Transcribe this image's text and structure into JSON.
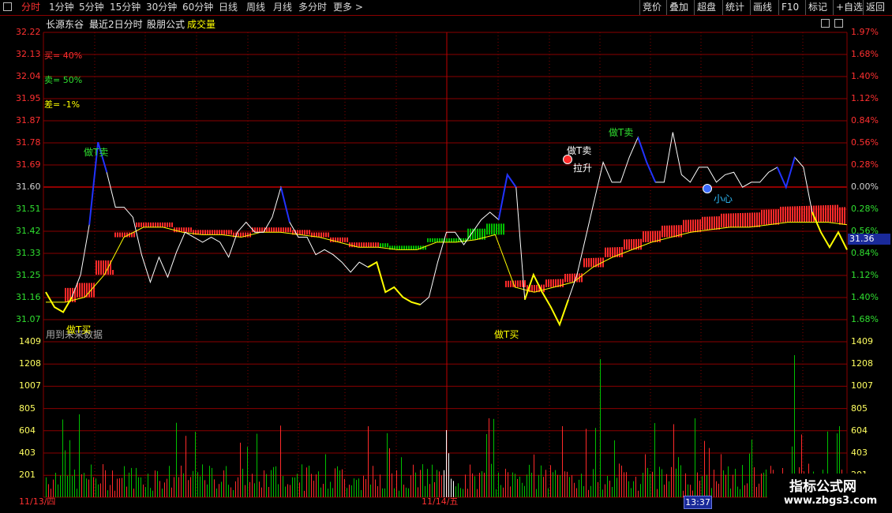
{
  "toolbar": {
    "tabs": [
      "分时",
      "1分钟",
      "5分钟",
      "15分钟",
      "30分钟",
      "60分钟",
      "日线",
      "周线",
      "月线",
      "多分时",
      "更多 >"
    ],
    "right_buttons": [
      "竞价",
      "叠加",
      "超盘",
      "统计",
      "画线",
      "F10",
      "标记",
      "+自选",
      "返回"
    ]
  },
  "header": {
    "stock_name": "长源东谷",
    "range_label": "最近2日分时",
    "formula_label": "股朋公式",
    "volume_label": "成交量"
  },
  "legend": {
    "buy": "买= 40%",
    "sell": "卖= 50%",
    "diff": "差= -1%"
  },
  "note": "用到未来数据",
  "price_axis_left": [
    "32.22",
    "32.13",
    "32.04",
    "31.95",
    "31.87",
    "31.78",
    "31.69",
    "31.60",
    "31.51",
    "31.42",
    "31.33",
    "31.25",
    "31.16",
    "31.07"
  ],
  "percent_axis_right": [
    "1.97%",
    "1.68%",
    "1.40%",
    "1.12%",
    "0.84%",
    "0.56%",
    "0.28%",
    "0.00%",
    "0.28%",
    "0.56%",
    "0.84%",
    "1.12%",
    "1.40%",
    "1.68%"
  ],
  "volume_axis": [
    "1409",
    "1208",
    "1007",
    "805",
    "604",
    "403",
    "201"
  ],
  "current_price": "31.36",
  "dates": [
    "11/13/四",
    "11/14/五"
  ],
  "cursor_time": "13:37",
  "annotations": {
    "t_sell": "做T卖",
    "t_buy": "做T买",
    "rise": "拉升",
    "careful": "小心"
  },
  "watermark": {
    "line1": "指标公式网",
    "line2": "www.zbgs3.com"
  },
  "colors": {
    "grid": "#8a0000",
    "price_line": "#ffffff",
    "avg_line": "#ffff00",
    "up": "#ff2a2a",
    "down": "#00c000",
    "blue_segment": "#2233ff",
    "yellow_segment": "#ffff00"
  },
  "chart_data": {
    "type": "line",
    "title": "",
    "x": [
      "11/13/四",
      "11/14/五"
    ],
    "ylim": [
      31.07,
      32.22
    ],
    "volume_ylim": [
      0,
      1409
    ],
    "series": [
      {
        "values": [
          31.18,
          31.12,
          31.1,
          31.16,
          31.25,
          31.45,
          31.78,
          31.66,
          31.52,
          31.52,
          31.48,
          31.33,
          31.22,
          31.32,
          31.24,
          31.34,
          31.42,
          31.4,
          31.38,
          31.4,
          31.38,
          31.32,
          31.42,
          31.46,
          31.42,
          31.42,
          31.48,
          31.6,
          31.46,
          31.4,
          31.4,
          31.33,
          31.35,
          31.33,
          31.3,
          31.26,
          31.3,
          31.28,
          31.3,
          31.18,
          31.2,
          31.16,
          31.14,
          31.13,
          31.16,
          31.3,
          31.42,
          31.42,
          31.37,
          31.42,
          31.47,
          31.5,
          31.47,
          31.65,
          31.6,
          31.15,
          31.25,
          31.18,
          31.12,
          31.05,
          31.15,
          31.25,
          31.4,
          31.55,
          31.7,
          31.62,
          31.62,
          31.72,
          31.8,
          31.7,
          31.62,
          31.62,
          31.82,
          31.65,
          31.62,
          31.68,
          31.68,
          31.62,
          31.65,
          31.66,
          31.6,
          31.62,
          31.62,
          31.66,
          31.68,
          31.6,
          31.72,
          31.68,
          31.5,
          31.42,
          31.36,
          31.42,
          31.35
        ]
      },
      {
        "values": [
          31.14,
          31.14,
          31.16,
          31.25,
          31.4,
          31.44,
          31.44,
          31.42,
          31.41,
          31.41,
          31.4,
          31.42,
          31.42,
          31.41,
          31.4,
          31.38,
          31.36,
          31.36,
          31.35,
          31.35,
          31.38,
          31.38,
          31.39,
          31.41,
          31.2,
          31.18,
          31.2,
          31.22,
          31.28,
          31.32,
          31.35,
          31.38,
          31.4,
          31.42,
          31.43,
          31.44,
          31.44,
          31.45,
          31.46,
          31.46,
          31.46,
          31.45
        ]
      }
    ]
  }
}
